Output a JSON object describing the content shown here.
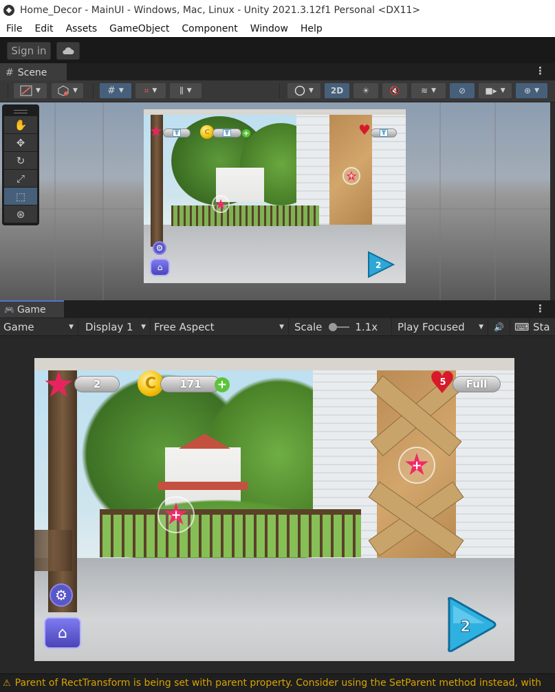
{
  "window": {
    "title": "Home_Decor - MainUI - Windows, Mac, Linux - Unity 2021.3.12f1 Personal <DX11>"
  },
  "menu": [
    "File",
    "Edit",
    "Assets",
    "GameObject",
    "Component",
    "Window",
    "Help"
  ],
  "toolbar": {
    "sign_in": "Sign in"
  },
  "scene": {
    "tab_label": "Scene",
    "toggle_2d": "2D"
  },
  "game": {
    "tab_label": "Game",
    "view_dropdown": "Game",
    "display": "Display 1",
    "aspect": "Free Aspect",
    "scale_label": "Scale",
    "scale_value": "1.1x",
    "play_mode": "Play Focused",
    "stats_partial": "Sta"
  },
  "hud": {
    "stars": "2",
    "coins": "171",
    "lives": "5",
    "lives_status": "Full",
    "level": "2"
  },
  "console": {
    "message": "Parent of RectTransform is being set with parent property. Consider using the SetParent method instead, with"
  },
  "colors": {
    "accent_selected": "#46607c",
    "warning": "#d9a300",
    "star_pink": "#e8245e"
  }
}
